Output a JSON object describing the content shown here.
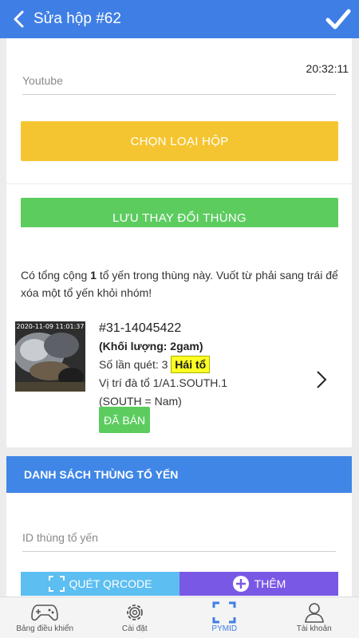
{
  "appbar": {
    "title": "Sửa hộp #62"
  },
  "form": {
    "time": "20:32:11",
    "name_placeholder": "Youtube",
    "choose_type_button": "CHỌN LOẠI HỘP",
    "save_button": "LƯU THAY ĐỔI THÙNG"
  },
  "info": {
    "prefix": "Có tổng cộng ",
    "count": "1",
    "suffix": " tổ yến trong thùng này. Vuốt từ phải sang trái để xóa một tổ yến khỏi nhóm!"
  },
  "item": {
    "timestamp": "2020-11-09 11:01:37",
    "code": "#31-14045422",
    "weight": "(Khối lượng: 2gam)",
    "scan_label": "Số lần quét: 3",
    "harvest_badge": "Hái tổ",
    "location": "Vị trí đà tổ 1/A1.SOUTH.1",
    "location_note": "(SOUTH = Nam)",
    "status_badge": "ĐÃ BÁN"
  },
  "box_list": {
    "title": "DANH SÁCH THÙNG TỔ YẾN",
    "id_placeholder": "ID thùng tổ yến",
    "scan_button": "QUÉT QRCODE",
    "add_button": "THÊM"
  },
  "nav": {
    "items": [
      {
        "label": "Bảng điều khiển",
        "icon": "gamepad-icon"
      },
      {
        "label": "Cài đặt",
        "icon": "gear-icon"
      },
      {
        "label": "PYMID",
        "icon": "scan-frame-icon"
      },
      {
        "label": "Tài khoản",
        "icon": "user-icon"
      }
    ]
  },
  "colors": {
    "primary": "#3f7ee5",
    "yellow_button": "#f5c531",
    "green_button": "#5ccc5f",
    "qr_button": "#5dbef1",
    "add_button": "#7a58e6"
  }
}
